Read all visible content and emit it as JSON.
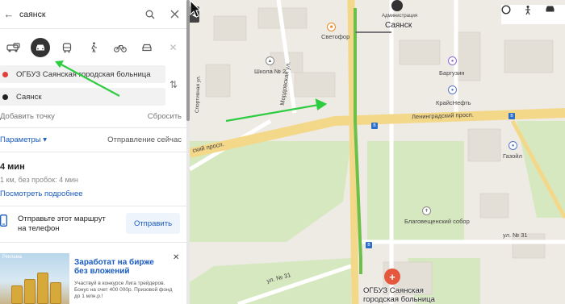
{
  "search": {
    "query": "саянск"
  },
  "transport_modes": [
    {
      "name": "taxi-icon",
      "active": false
    },
    {
      "name": "car-icon",
      "active": true
    },
    {
      "name": "bus-icon",
      "active": false
    },
    {
      "name": "pedestrian-icon",
      "active": false
    },
    {
      "name": "bicycle-icon",
      "active": false
    },
    {
      "name": "car-sharing-icon",
      "active": false
    }
  ],
  "route": {
    "from": "ОГБУЗ Саянская городская больница",
    "to": "Саянск",
    "from_color": "#e0403a",
    "to_color": "#222222",
    "add_point": "Добавить точку",
    "reset": "Сбросить",
    "params": "Параметры",
    "departure": "Отправление сейчас",
    "time": "4 мин",
    "distance": "1 км, без пробок: 4 мин",
    "more": "Посмотреть подробнее",
    "send_text": "Отправьте этот маршрут на телефон",
    "send_button": "Отправить"
  },
  "ad": {
    "label": "Реклама",
    "title": "Заработат на бирже без вложений",
    "body": "Участвуй в конкурсе Лига трейдеров. Бонус на счет 400 000р. Призовой фонд до 1 млн.р.!"
  },
  "map": {
    "labels": {
      "city_top": "Саянск",
      "city_top_small": "Администрация",
      "svetofor": "Светофор",
      "school": "Школа № 2",
      "barguzin": "Баргузин",
      "krais_neft": "КрайсНефть",
      "leningradsky": "Ленинградский просп.",
      "leningradsky_left": "ский просп.",
      "mordovskaya": "Мордовская ул.",
      "sportivnaya": "Спортивная ул.",
      "gazoil": "Газойл",
      "church": "Благовещенский собор",
      "street_31_left": "ул. № 31",
      "street_31_right": "ул. № 31",
      "dest_1": "ОГБУЗ Саянская",
      "dest_2": "городская больница"
    },
    "route_color": "#6cc04a",
    "road_color": "#f4d88a"
  },
  "annotations": {
    "arrow_color": "#2ecc40"
  }
}
